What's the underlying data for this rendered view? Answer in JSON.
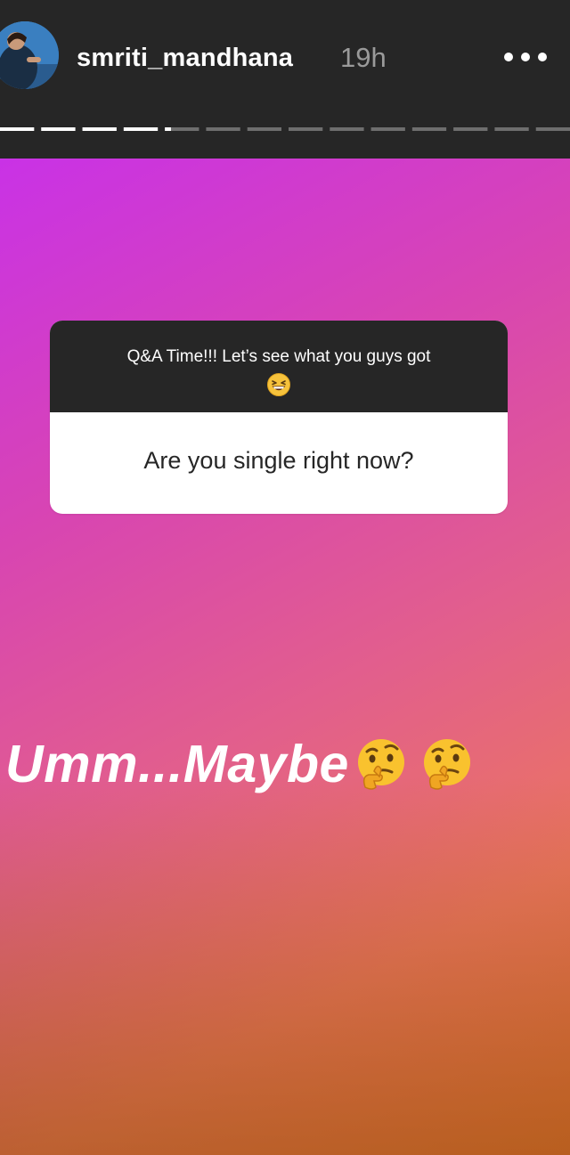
{
  "header": {
    "username": "smriti_mandhana",
    "time_ago": "19h",
    "more_icon": "more-horizontal-icon",
    "progress_segments": 14,
    "progress_active_segments": 4,
    "progress_active_fraction": 0.3
  },
  "story": {
    "background_colors": [
      "#c932e6",
      "#d845b2",
      "#e25f8c",
      "#eb7560",
      "#e27038"
    ],
    "qa_sticker": {
      "prompt": "Q&A Time!!! Let’s see what you guys got",
      "prompt_emoji": "grinning-squinting-face-icon",
      "question": "Are you single right now?"
    },
    "answer": {
      "text": "Umm...Maybe",
      "emojis": [
        "thinking-face-icon",
        "thinking-face-icon"
      ]
    }
  }
}
